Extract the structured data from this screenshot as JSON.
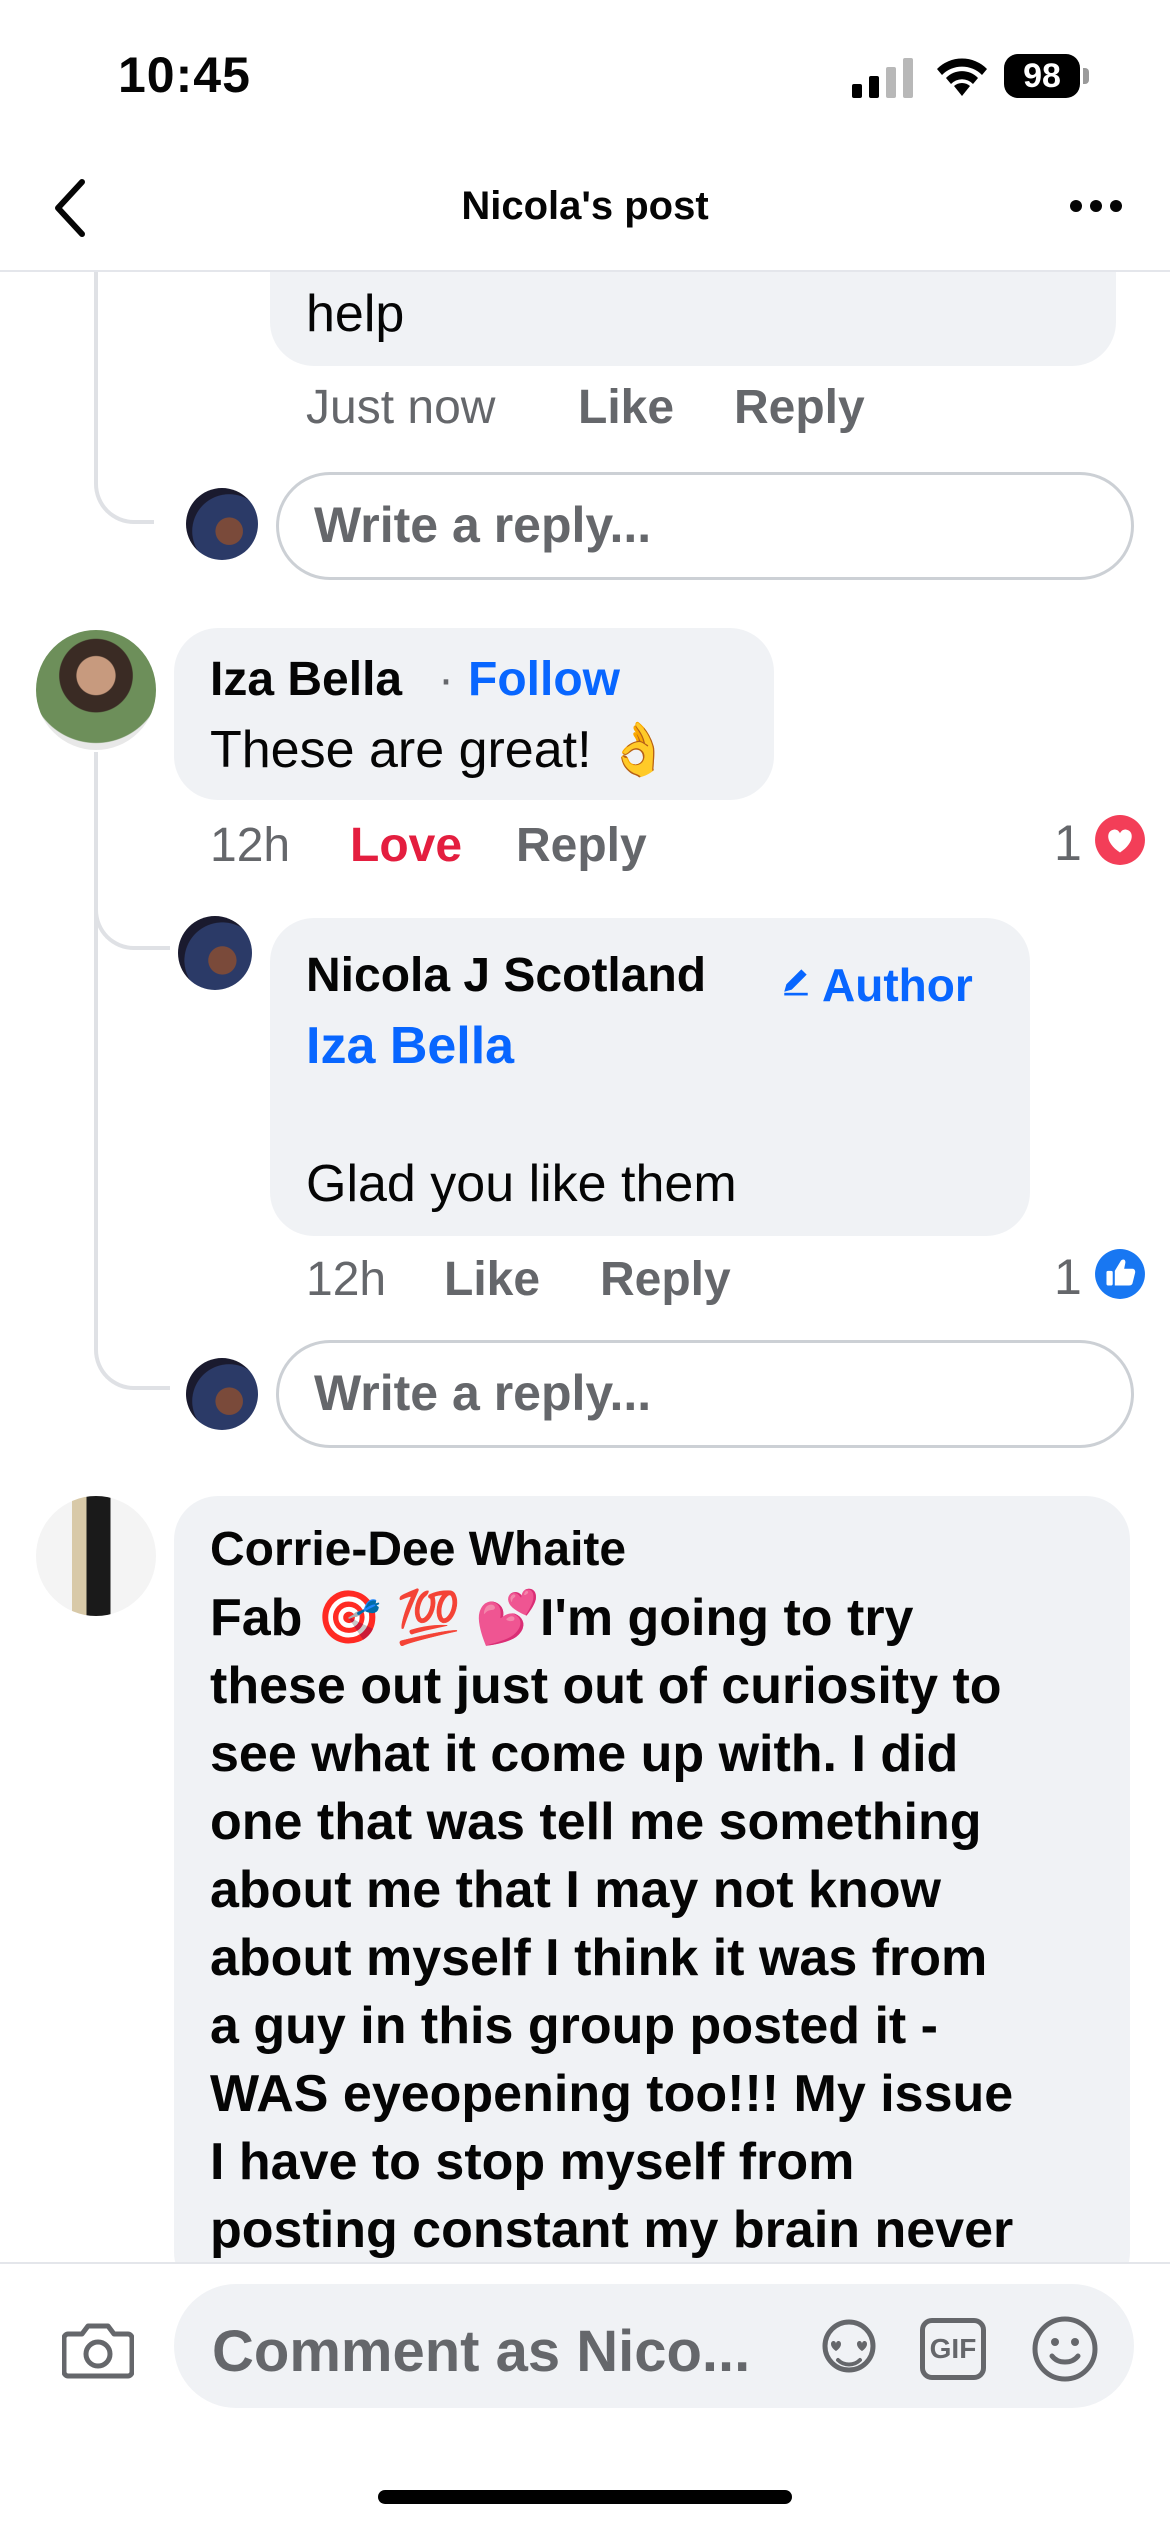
{
  "status_bar": {
    "time": "10:45",
    "battery": "98"
  },
  "header": {
    "title": "Nicola's post"
  },
  "comments": [
    {
      "partial_text": "help",
      "time": "Just now",
      "like": "Like",
      "reply": "Reply",
      "write_reply": "Write a reply..."
    },
    {
      "name": "Iza Bella",
      "separator": "·",
      "follow": "Follow",
      "text": "These are great! 👌",
      "time": "12h",
      "reaction_label": "Love",
      "reply": "Reply",
      "reaction_count": "1",
      "reaction_type": "love",
      "replies": [
        {
          "name": "Nicola J Scotland",
          "badge": "Author",
          "mention": "Iza Bella",
          "text": "Glad you like them",
          "time": "12h",
          "like": "Like",
          "reply": "Reply",
          "reaction_count": "1",
          "reaction_type": "like"
        }
      ],
      "write_reply": "Write a reply..."
    },
    {
      "name": "Corrie-Dee Whaite",
      "text_lines": [
        "Fab 🎯 💯 💕I'm going to try",
        "these out just out of curiosity to",
        "see what it come up with. I did",
        "one that was tell me something",
        "about me that I may not know",
        "about myself I think it was from",
        "a guy in this group posted it -",
        "WAS eyeopening too!!! My issue",
        "I have to stop myself from",
        "posting constant my brain never"
      ]
    }
  ],
  "composer": {
    "placeholder": "Comment as Nico...",
    "gif_label": "GIF"
  },
  "colors": {
    "accent": "#0866ff",
    "love": "#e41e3f",
    "bubble": "#f0f2f5",
    "muted": "#65676b"
  }
}
